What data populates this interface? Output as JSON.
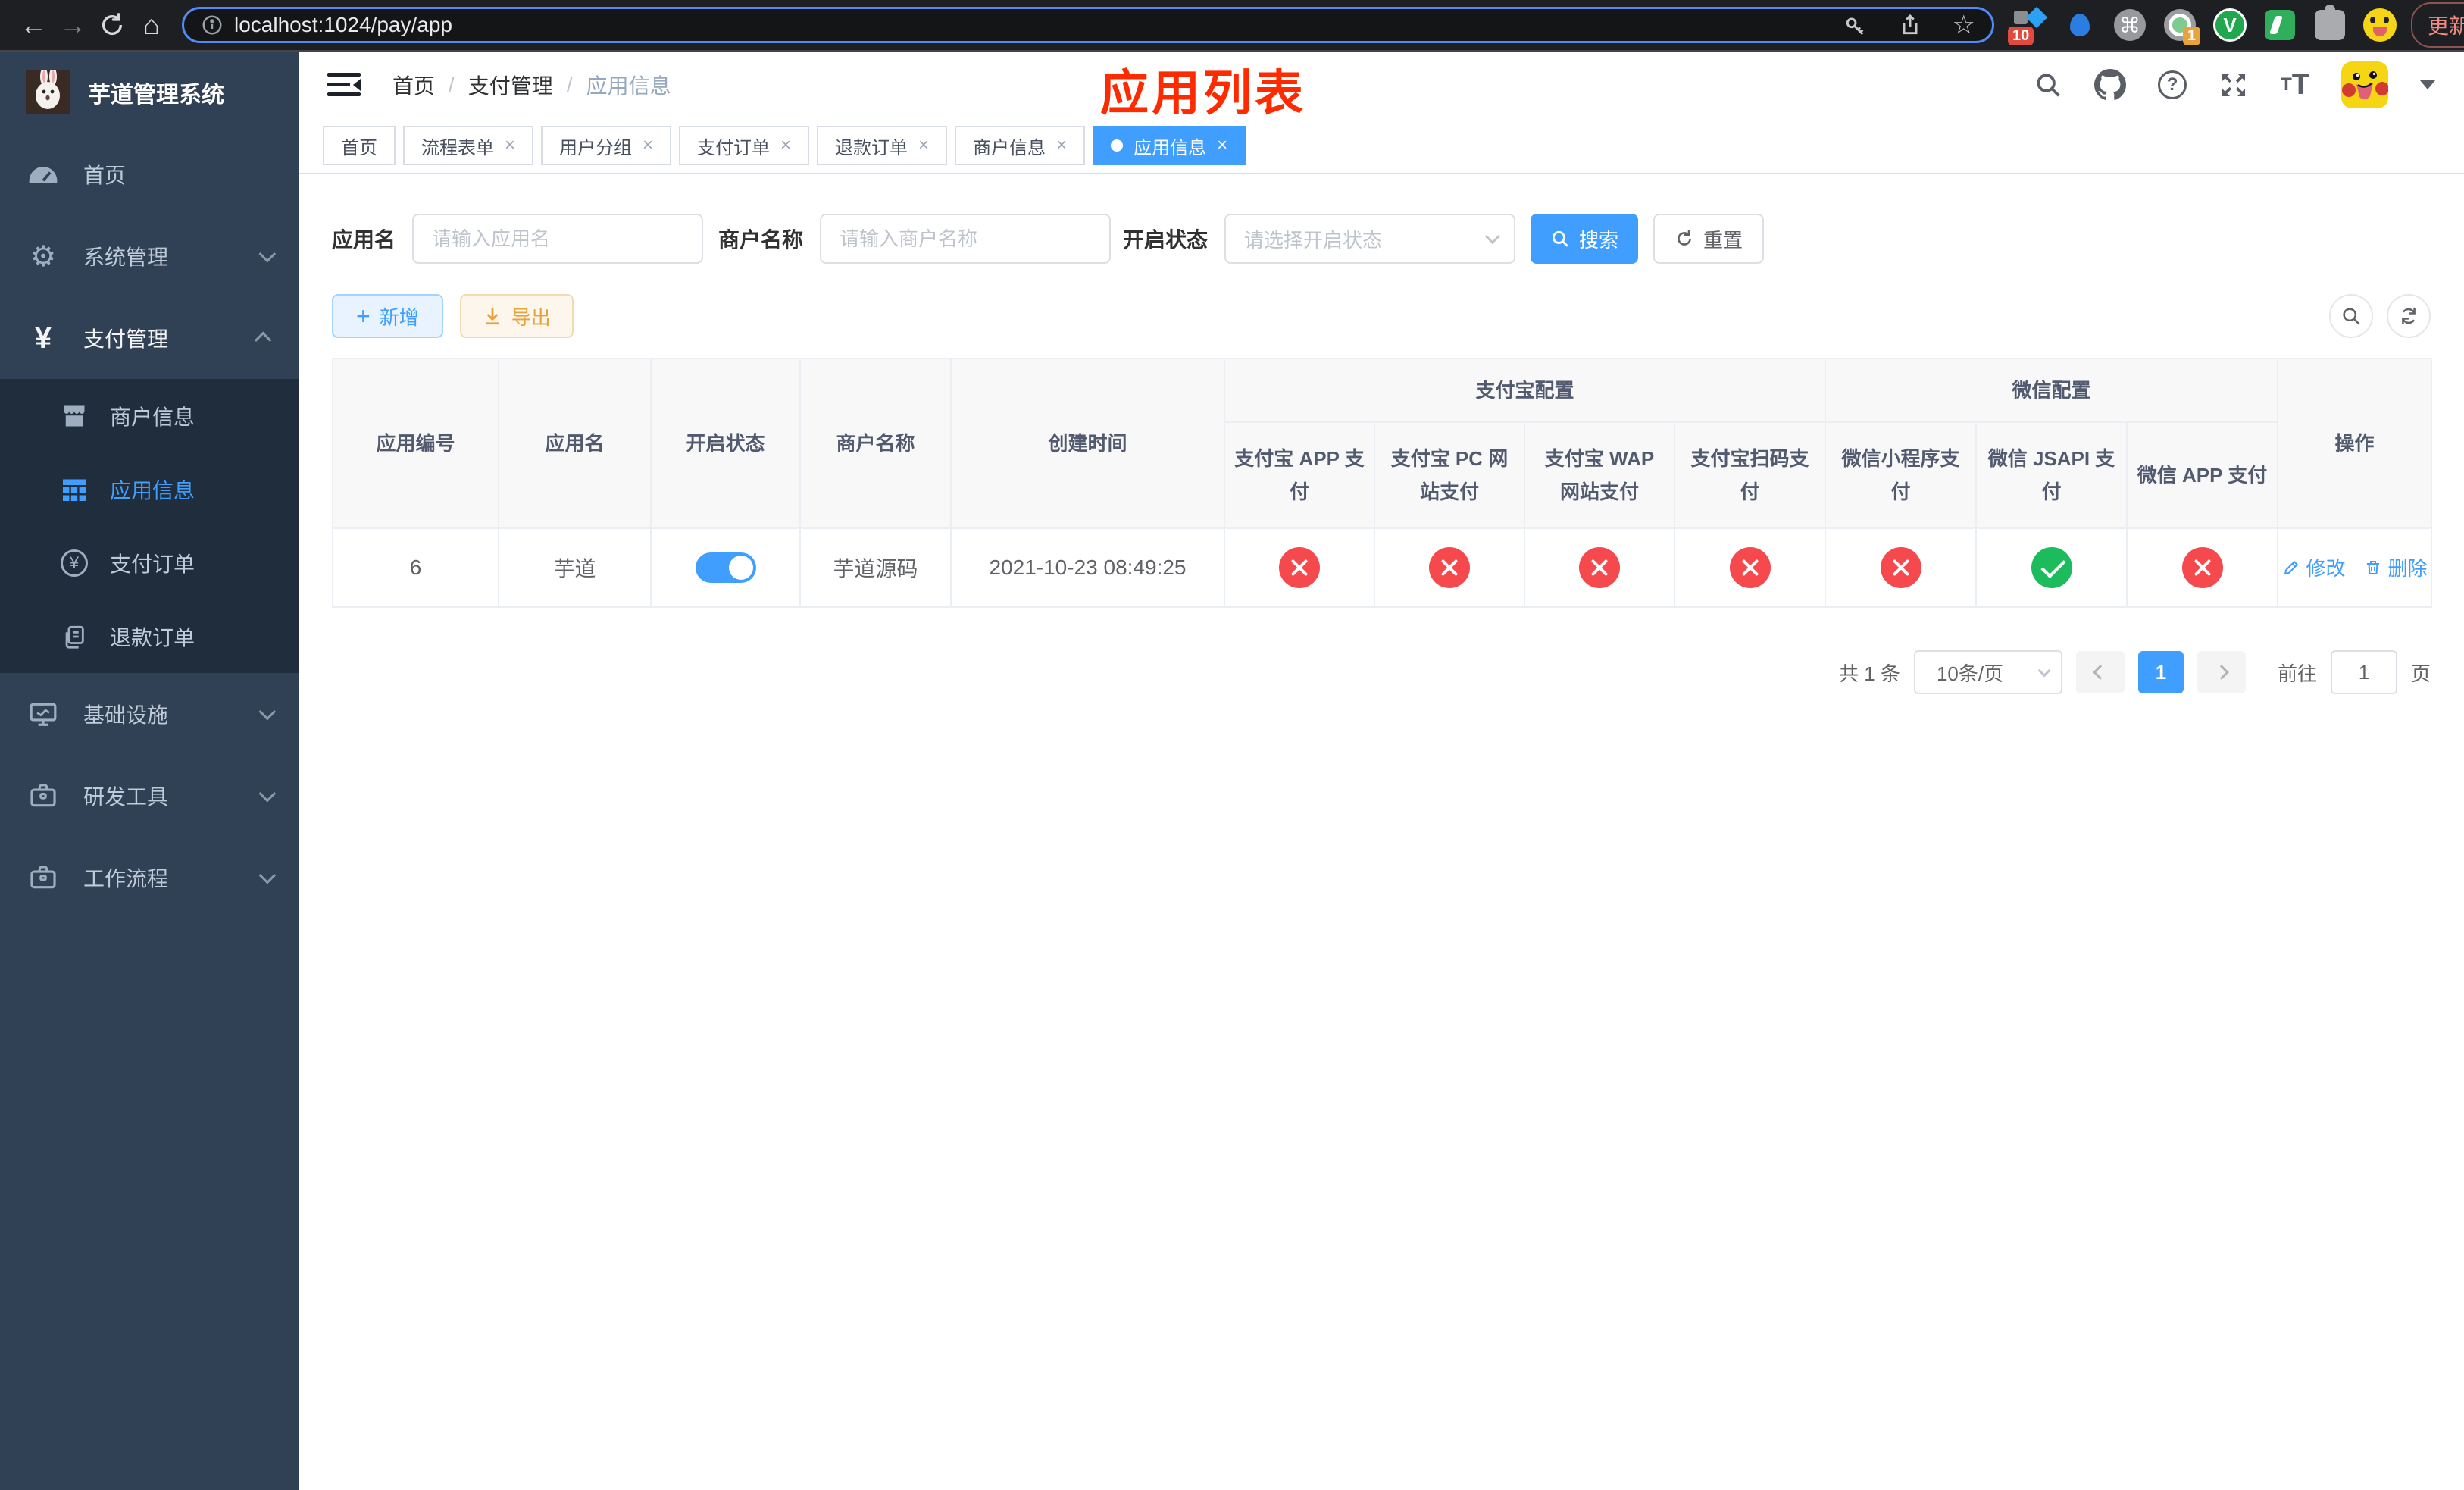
{
  "browser": {
    "url": "localhost:1024/pay/app",
    "update_label": "更新",
    "ext_grid_badge": "10",
    "ext_record_badge": "1",
    "ext_v_label": "V"
  },
  "sidebar": {
    "title": "芋道管理系统",
    "items": [
      {
        "label": "首页"
      },
      {
        "label": "系统管理"
      },
      {
        "label": "支付管理"
      },
      {
        "label": "基础设施"
      },
      {
        "label": "研发工具"
      },
      {
        "label": "工作流程"
      }
    ],
    "submenu": [
      {
        "label": "商户信息"
      },
      {
        "label": "应用信息"
      },
      {
        "label": "支付订单"
      },
      {
        "label": "退款订单"
      }
    ]
  },
  "header": {
    "breadcrumb": [
      "首页",
      "支付管理",
      "应用信息"
    ]
  },
  "annotation": "应用列表",
  "tabs": [
    {
      "label": "首页"
    },
    {
      "label": "流程表单"
    },
    {
      "label": "用户分组"
    },
    {
      "label": "支付订单"
    },
    {
      "label": "退款订单"
    },
    {
      "label": "商户信息"
    },
    {
      "label": "应用信息"
    }
  ],
  "filters": {
    "app_name_label": "应用名",
    "app_name_placeholder": "请输入应用名",
    "merchant_label": "商户名称",
    "merchant_placeholder": "请输入商户名称",
    "status_label": "开启状态",
    "status_placeholder": "请选择开启状态",
    "search_label": "搜索",
    "reset_label": "重置"
  },
  "toolbar": {
    "add_label": "新增",
    "export_label": "导出"
  },
  "table": {
    "columns": {
      "app_id": "应用编号",
      "app_name": "应用名",
      "status": "开启状态",
      "merchant": "商户名称",
      "created": "创建时间",
      "alipay_group": "支付宝配置",
      "wechat_group": "微信配置",
      "alipay_app": "支付宝 APP 支付",
      "alipay_pc": "支付宝 PC 网站支付",
      "alipay_wap": "支付宝 WAP 网站支付",
      "alipay_qr": "支付宝扫码支付",
      "wechat_lite": "微信小程序支付",
      "wechat_jsapi": "微信 JSAPI 支付",
      "wechat_app": "微信 APP 支付",
      "actions": "操作"
    },
    "row": {
      "app_id": "6",
      "app_name": "芋道",
      "enabled": true,
      "merchant": "芋道源码",
      "created": "2021-10-23 08:49:25",
      "statuses": [
        false,
        false,
        false,
        false,
        false,
        true,
        false
      ],
      "edit_label": "修改",
      "delete_label": "删除"
    }
  },
  "pagination": {
    "total": "共 1 条",
    "page_size": "10条/页",
    "page": "1",
    "goto_label": "前往",
    "goto_value": "1",
    "unit_label": "页"
  },
  "colors": {
    "accent": "#409eff",
    "status_on": "#1cbb5c",
    "status_off": "#f5494d",
    "annotation_red": "#fe2b01",
    "sidebar_bg": "#304156",
    "submenu_bg": "#1f2d3d"
  }
}
